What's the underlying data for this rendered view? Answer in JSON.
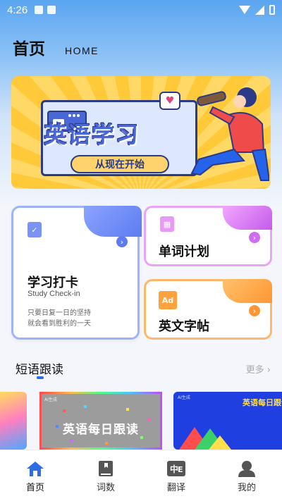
{
  "status_bar": {
    "time": "4:26"
  },
  "header": {
    "title": "首页",
    "subtitle": "HOME"
  },
  "banner": {
    "title": "英语学习",
    "subtitle": "从现在开始"
  },
  "cards": {
    "checkin": {
      "title": "学习打卡",
      "subtitle": "Study Check-in",
      "desc_line1": "只要日复一日的坚持",
      "desc_line2": "就会看到胜利的一天",
      "icon": "clipboard-check-icon",
      "color": "#6a86f2"
    },
    "word_plan": {
      "title": "单词计划",
      "icon": "calendar-icon",
      "color": "#c55bea"
    },
    "copybook": {
      "title": "英文字帖",
      "icon": "ad-icon",
      "badge": "Ad",
      "color": "#ff9633"
    }
  },
  "section": {
    "title": "短语跟读",
    "more": "更多"
  },
  "thumbnails": [
    {
      "title": ""
    },
    {
      "title": "英语每日跟读",
      "tag": "AI生成"
    },
    {
      "title": "英语每日跟读",
      "tag": "AI生成"
    }
  ],
  "bottom_nav": [
    {
      "label": "首页",
      "icon": "home-icon",
      "active": true
    },
    {
      "label": "词数",
      "icon": "book-icon",
      "active": false
    },
    {
      "label": "翻译",
      "icon": "translate-icon",
      "active": false
    },
    {
      "label": "我的",
      "icon": "user-icon",
      "active": false
    }
  ],
  "colors": {
    "accent": "#2d6fe0",
    "banner_yellow": "#ffc93a",
    "banner_blue": "#4a67d6"
  }
}
